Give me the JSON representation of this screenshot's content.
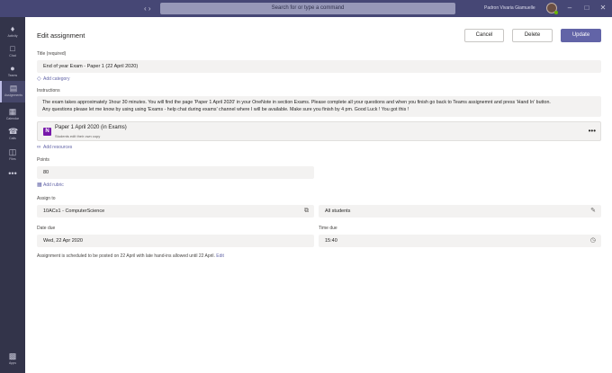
{
  "titlebar": {
    "search_placeholder": "Search for or type a command",
    "profile_name": "Padron Vivaria Giamuelle",
    "back_icon": "chevron-left-icon",
    "forward_icon": "chevron-right-icon",
    "colors": {
      "bar": "#464775",
      "rail": "#33344a",
      "accent": "#6264a7"
    }
  },
  "rail": {
    "items": [
      {
        "label": "Activity",
        "icon": "bell-icon"
      },
      {
        "label": "Chat",
        "icon": "chat-icon"
      },
      {
        "label": "Teams",
        "icon": "teams-icon"
      },
      {
        "label": "Assignments",
        "icon": "assignments-icon",
        "active": true
      },
      {
        "label": "Calendar",
        "icon": "calendar-icon"
      },
      {
        "label": "Calls",
        "icon": "phone-icon"
      },
      {
        "label": "Files",
        "icon": "file-icon"
      },
      {
        "label": "",
        "icon": "more-icon"
      },
      {
        "label": "Apps",
        "icon": "apps-icon"
      }
    ]
  },
  "page": {
    "title": "Edit assignment",
    "cancel_label": "Cancel",
    "delete_label": "Delete",
    "update_label": "Update"
  },
  "form": {
    "title_label": "Title (required)",
    "title_value": "End of year Exam - Paper 1 (22 April 2020)",
    "add_category": "Add category",
    "instructions_label": "Instructions",
    "instructions_line1": "The exam takes approximately 1hour 30 minutes. You will find the page 'Paper 1 April 2020' in your OneNote in section Exams. Please complete all your questions and when you finish go back to Teams assignemnt and press 'Hand In' button.",
    "instructions_line2": "Any questions please let me know by using using 'Exams  -  help chat during exams' channel where I will be available.  Make sure you finish by 4 pm. Good Luck ! You got this !",
    "resource_title": "Paper 1 April 2020 (in Exams)",
    "resource_subtitle": "Students edit their own copy",
    "add_resources": "Add resources",
    "points_label": "Points",
    "points_value": "80",
    "add_rubric": "Add rubric",
    "assign_to_label": "Assign to",
    "class_value": "10ACs1 - ComputerScience",
    "students_value": "All students",
    "date_due_label": "Date due",
    "date_due_value": "Wed, 22 Apr 2020",
    "time_due_label": "Time due",
    "time_due_value": "15:40",
    "schedule_note": "Assignment is scheduled to be posted on 22 April with late hand-ins allowed until 22 April.",
    "schedule_edit": "Edit"
  }
}
